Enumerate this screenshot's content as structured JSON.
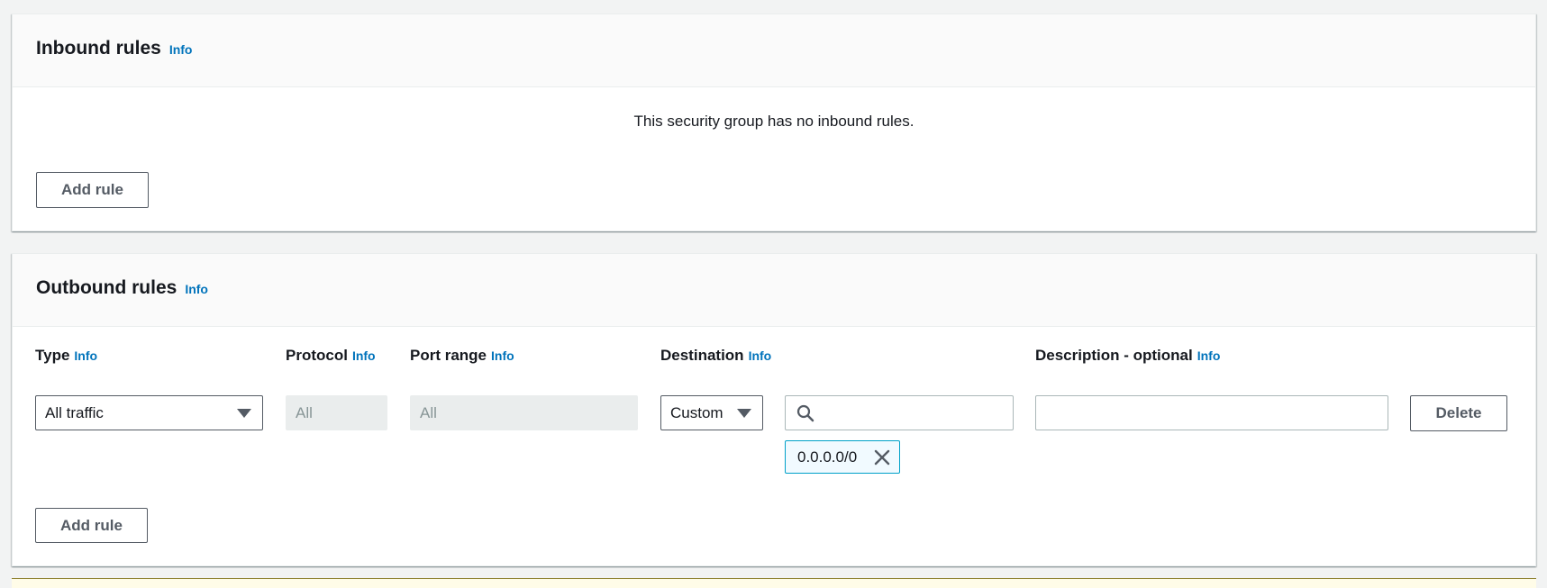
{
  "inbound": {
    "title": "Inbound rules",
    "info": "Info",
    "empty_message": "This security group has no inbound rules.",
    "add_rule": "Add rule"
  },
  "outbound": {
    "title": "Outbound rules",
    "info": "Info",
    "columns": {
      "type": "Type",
      "protocol": "Protocol",
      "port_range": "Port range",
      "destination": "Destination",
      "description": "Description - optional"
    },
    "column_info": "Info",
    "rule": {
      "type": "All traffic",
      "protocol": "All",
      "port_range": "All",
      "destination_mode": "Custom",
      "destination_search": "",
      "destination_token": "0.0.0.0/0",
      "description": ""
    },
    "delete": "Delete",
    "add_rule": "Add rule"
  },
  "colors": {
    "link": "#0073bb",
    "token_border": "#00a1c9",
    "page_bg": "#f2f3f3"
  },
  "icons": {
    "type_select": "caret-down-icon",
    "destination_select": "caret-down-icon",
    "search": "search-icon",
    "token_remove": "close-icon"
  }
}
